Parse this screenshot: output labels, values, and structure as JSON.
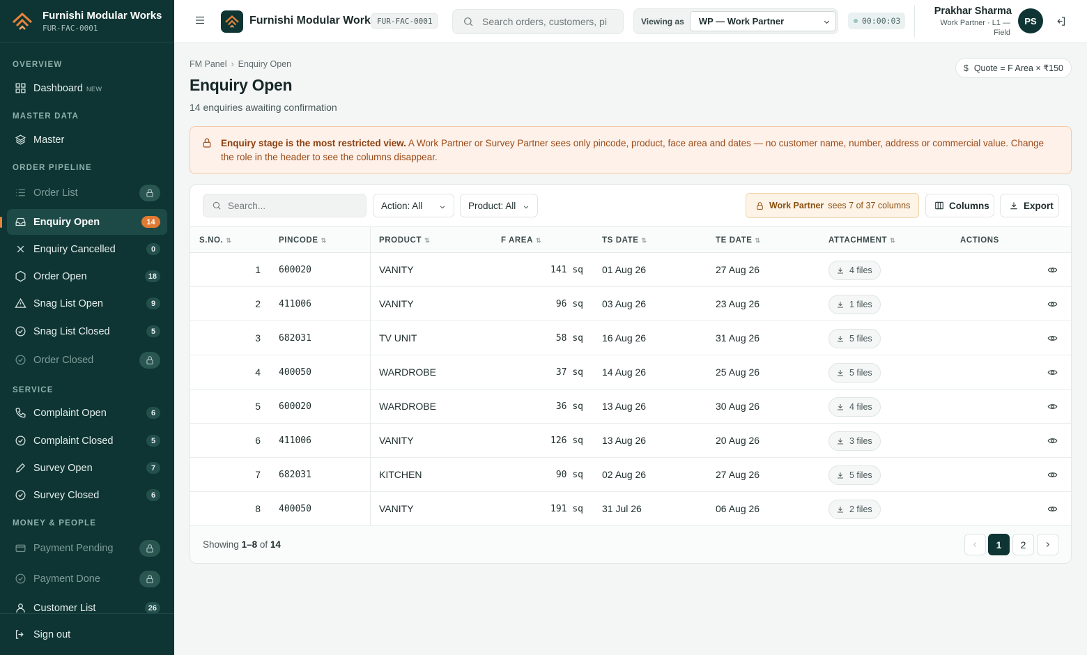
{
  "app": {
    "name": "Furnishi Modular Works",
    "code": "FUR-FAC-0001"
  },
  "header": {
    "search_placeholder": "Search orders, customers, pincodes",
    "viewing_label": "Viewing as",
    "viewing_value": "WP — Work Partner",
    "timer": "00:00:03",
    "user_name": "Prakhar Sharma",
    "user_role": "Work Partner · L1 — Field",
    "avatar_initials": "PS"
  },
  "sidebar": {
    "sections": [
      {
        "label": "OVERVIEW"
      },
      {
        "label": "MASTER DATA"
      },
      {
        "label": "ORDER PIPELINE"
      },
      {
        "label": "SERVICE"
      },
      {
        "label": "MONEY & PEOPLE"
      }
    ],
    "items": [
      {
        "label": "Dashboard",
        "tag": "NEW",
        "icon": "grid-icon"
      },
      {
        "label": "Master",
        "icon": "layers-icon"
      },
      {
        "label": "Order List",
        "locked": true,
        "icon": "list-icon"
      },
      {
        "label": "Enquiry Open",
        "count": "14",
        "active": true,
        "icon": "inbox-icon"
      },
      {
        "label": "Enquiry Cancelled",
        "count": "0",
        "icon": "x-icon"
      },
      {
        "label": "Order Open",
        "count": "18",
        "icon": "hexagon-icon"
      },
      {
        "label": "Snag List Open",
        "count": "9",
        "icon": "alert-triangle-icon"
      },
      {
        "label": "Snag List Closed",
        "count": "5",
        "icon": "check-circle-icon"
      },
      {
        "label": "Order Closed",
        "locked": true,
        "icon": "check-circle-icon"
      },
      {
        "label": "Complaint Open",
        "count": "6",
        "icon": "phone-icon"
      },
      {
        "label": "Complaint Closed",
        "count": "5",
        "icon": "check-circle-icon"
      },
      {
        "label": "Survey Open",
        "count": "7",
        "icon": "pencil-icon"
      },
      {
        "label": "Survey Closed",
        "count": "6",
        "icon": "check-circle-icon"
      },
      {
        "label": "Payment Pending",
        "locked": true,
        "icon": "wallet-icon"
      },
      {
        "label": "Payment Done",
        "locked": true,
        "icon": "check-circle-icon"
      },
      {
        "label": "Customer List",
        "count": "26",
        "icon": "user-icon"
      }
    ],
    "signout": "Sign out"
  },
  "page": {
    "breadcrumb": [
      "FM Panel",
      "Enquiry Open"
    ],
    "quote": "Quote = F Area × ₹150",
    "title": "Enquiry Open",
    "subtitle": "14 enquiries awaiting confirmation",
    "alert_bold": "Enquiry stage is the most restricted view.",
    "alert_text": " A Work Partner or Survey Partner sees only pincode, product, face area and dates — no customer name, number, address or commercial value. Change the role in the header to see the columns disappear."
  },
  "toolbar": {
    "search_placeholder": "Search...",
    "action_filter": "Action: All",
    "product_filter": "Product: All",
    "role_name": "Work Partner",
    "role_columns": "sees 7 of 37 columns",
    "columns_label": "Columns",
    "export_label": "Export"
  },
  "table": {
    "columns": [
      "S.NO.",
      "PINCODE",
      "PRODUCT",
      "F AREA",
      "TS DATE",
      "TE DATE",
      "ATTACHMENT",
      "ACTIONS"
    ],
    "rows": [
      {
        "sno": "1",
        "pincode": "600020",
        "product": "VANITY",
        "area": "141 sq",
        "ts": "01 Aug 26",
        "te": "27 Aug 26",
        "files": "4 files"
      },
      {
        "sno": "2",
        "pincode": "411006",
        "product": "VANITY",
        "area": "96 sq",
        "ts": "03 Aug 26",
        "te": "23 Aug 26",
        "files": "1 files"
      },
      {
        "sno": "3",
        "pincode": "682031",
        "product": "TV UNIT",
        "area": "58 sq",
        "ts": "16 Aug 26",
        "te": "31 Aug 26",
        "files": "5 files"
      },
      {
        "sno": "4",
        "pincode": "400050",
        "product": "WARDROBE",
        "area": "37 sq",
        "ts": "14 Aug 26",
        "te": "25 Aug 26",
        "files": "5 files"
      },
      {
        "sno": "5",
        "pincode": "600020",
        "product": "WARDROBE",
        "area": "36 sq",
        "ts": "13 Aug 26",
        "te": "30 Aug 26",
        "files": "4 files"
      },
      {
        "sno": "6",
        "pincode": "411006",
        "product": "VANITY",
        "area": "126 sq",
        "ts": "13 Aug 26",
        "te": "20 Aug 26",
        "files": "3 files"
      },
      {
        "sno": "7",
        "pincode": "682031",
        "product": "KITCHEN",
        "area": "90 sq",
        "ts": "02 Aug 26",
        "te": "27 Aug 26",
        "files": "5 files"
      },
      {
        "sno": "8",
        "pincode": "400050",
        "product": "VANITY",
        "area": "191 sq",
        "ts": "31 Jul 26",
        "te": "06 Aug 26",
        "files": "2 files"
      }
    ]
  },
  "pagination": {
    "showing_prefix": "Showing",
    "range": "1–8",
    "of_label": "of",
    "total": "14",
    "pages": [
      "1",
      "2"
    ]
  },
  "colors": {
    "sidebar_bg": "#0e3533",
    "accent": "#e07a33",
    "alert_bg": "#fdf1e9"
  }
}
